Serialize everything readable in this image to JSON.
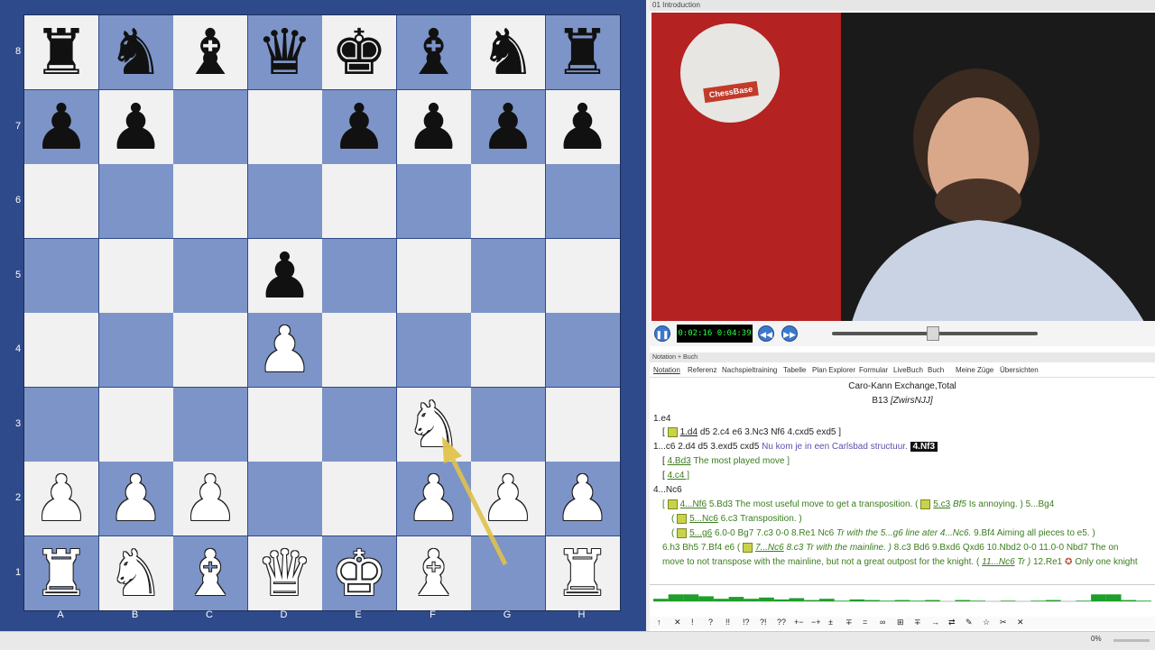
{
  "board": {
    "files": [
      "A",
      "B",
      "C",
      "D",
      "E",
      "F",
      "G",
      "H"
    ],
    "ranks": [
      "8",
      "7",
      "6",
      "5",
      "4",
      "3",
      "2",
      "1"
    ],
    "position": [
      [
        "r",
        "n",
        "b",
        "q",
        "k",
        "b",
        "n",
        "r"
      ],
      [
        "p",
        "p",
        "",
        "",
        "p",
        "p",
        "p",
        "p"
      ],
      [
        "",
        "",
        "",
        "",
        "",
        "",
        "",
        ""
      ],
      [
        "",
        "",
        "",
        "p",
        "",
        "",
        "",
        ""
      ],
      [
        "",
        "",
        "",
        "P",
        "",
        "",
        "",
        ""
      ],
      [
        "",
        "",
        "",
        "",
        "",
        "N",
        "",
        ""
      ],
      [
        "P",
        "P",
        "P",
        "",
        "",
        "P",
        "P",
        "P"
      ],
      [
        "R",
        "N",
        "B",
        "Q",
        "K",
        "B",
        "",
        "R"
      ]
    ],
    "last_move_arrow": {
      "from": "g1",
      "to": "f3",
      "color": "#e0c24a"
    }
  },
  "video": {
    "title": "01 Introduction",
    "logo_text": "ChessBase",
    "timecode": "0:02:16 0:04:39",
    "progress": 0.49,
    "buttons": {
      "pause": "❚❚",
      "rewind": "◀◀",
      "forward": "▶▶"
    }
  },
  "notation": {
    "panel_title": "Notation + Buch",
    "tabs": [
      "Notation",
      "Referenz",
      "Nachspieltraining",
      "Tabelle",
      "Plan Explorer",
      "Formular",
      "LiveBuch",
      "Buch",
      "Meine Züge",
      "Übersichten"
    ],
    "header_title": "Caro-Kann Exchange,Total",
    "header_eco": "B13",
    "header_annotator": "[ZwirsNJJ]",
    "lines": {
      "l1": "1.e4",
      "l2_a": "1.d4",
      "l2_b": "d5  2.c4  e6  3.Nc3  Nf6  4.cxd5  exd5 ]",
      "l3_a": "1...c6  2.d4  d5  3.exd5  cxd5",
      "l3_comment": "Nu kom je in een Carlsbad structuur.",
      "l3_current": "4.Nf3",
      "l4_a": "4.Bd3",
      "l4_comment": "The most played move ]",
      "l5_a": "4.c4 ]",
      "l6": "4...Nc6",
      "l7_a": "4...Nf6",
      "l7_b": "5.Bd3",
      "l7_comment": "The most useful move to get a transposition.",
      "l7_c": "5.c3",
      "l7_d": "Bf5",
      "l7_comment2": "Is annoying. )",
      "l7_e": "5...Bg4",
      "l8_a": "5...Nc6",
      "l8_b": "6.c3",
      "l8_comment": "Transposition. )",
      "l9_a": "5...g6",
      "l9_b": "6.0-0  Bg7  7.c3  0-0  8.Re1  Nc6",
      "l9_comment": "Tr with the 5...g6 line ater 4...Nc6.",
      "l9_c": "9.Bf4",
      "l9_comment2": "Aiming all pieces to e5. )",
      "l10_a": "6.h3  Bh5  7.Bf4  e6",
      "l10_b": "7...Nc6",
      "l10_c": "8.c3",
      "l10_comment": "Tr with the mainline. )",
      "l10_d": "8.c3  Bd6  9.Bxd6  Qxd6  10.Nbd2  0-0  11.0-0  Nbd7",
      "l10_comment2": "The on",
      "l11_comment": "move to not transpose with the mainline, but not a great outpost for the knight.",
      "l11_a": "11...Nc6",
      "l11_b": "Tr )",
      "l11_c": "12.Re1",
      "l11_comment2": "Only one knight"
    }
  },
  "eval_graph": {
    "values": [
      0.2,
      0.55,
      0.55,
      0.4,
      0.2,
      0.35,
      0.2,
      0.3,
      0.15,
      0.25,
      0.1,
      0.2,
      0.05,
      0.15,
      0.1,
      0.05,
      0.1,
      0.05,
      0.1,
      0.0,
      0.1,
      0.05,
      0.0,
      0.05,
      0.0,
      0.05,
      0.1,
      0.0,
      0.05,
      0.55,
      0.55,
      0.1,
      0.05
    ],
    "color": "#1e9e2a"
  },
  "icon_bar": {
    "icons": [
      "↑",
      "✕",
      "!",
      "?",
      "!!",
      "!?",
      "?!",
      "??",
      "+−",
      "−+",
      "±",
      "∓",
      "=",
      "∞",
      "⊞",
      "∓",
      "→",
      "⇄",
      "✎",
      "☆",
      "✂",
      "✕"
    ]
  },
  "status": {
    "zoom": "0%"
  }
}
